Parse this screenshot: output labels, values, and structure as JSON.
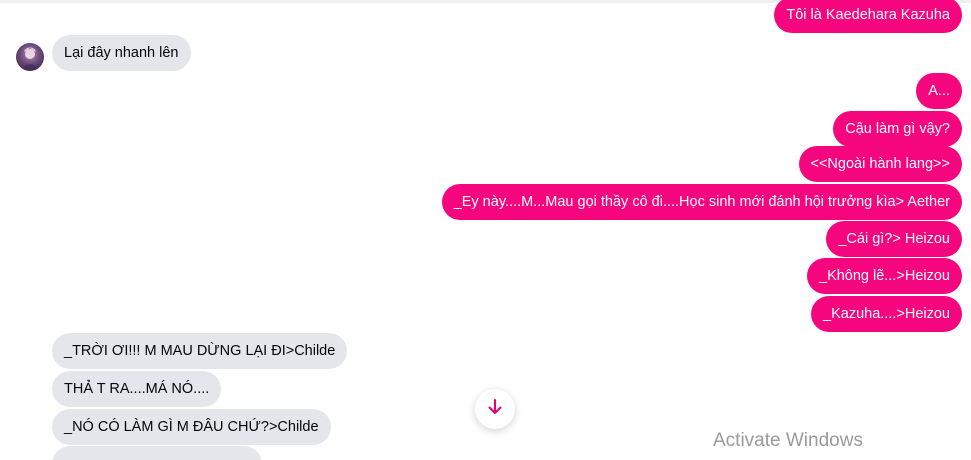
{
  "messages": {
    "m0": "Tôi là Kaedehara Kazuha",
    "m1": "Lại đây nhanh lên",
    "m2": "A...",
    "m3": "Cậu làm gì vậy?",
    "m4": "<<Ngoài hành lang>>",
    "m5": "_Ey này....M...Mau gọi thầy cô đi....Học sinh mới đánh hội trưởng kìa> Aether",
    "m6": "_Cái gì?> Heizou",
    "m7": "_Không lẽ...>Heizou",
    "m8": "_Kazuha....>Heizou",
    "m9": "_TRỜI ƠI!!! M MAU DỪNG LẠI ĐI>Childe",
    "m10": "THẢ T RA....MÁ NÓ....",
    "m11": "_NÓ CÓ LÀM GÌ M ĐÂU CHỨ?>Childe"
  },
  "icons": {
    "scroll_down": "arrow-down-icon",
    "avatar": "avatar"
  },
  "colors": {
    "outgoing_bubble": "#f5067f",
    "incoming_bubble": "#e4e6eb",
    "scroll_arrow": "#e5006e"
  },
  "watermark": "Activate Windows"
}
